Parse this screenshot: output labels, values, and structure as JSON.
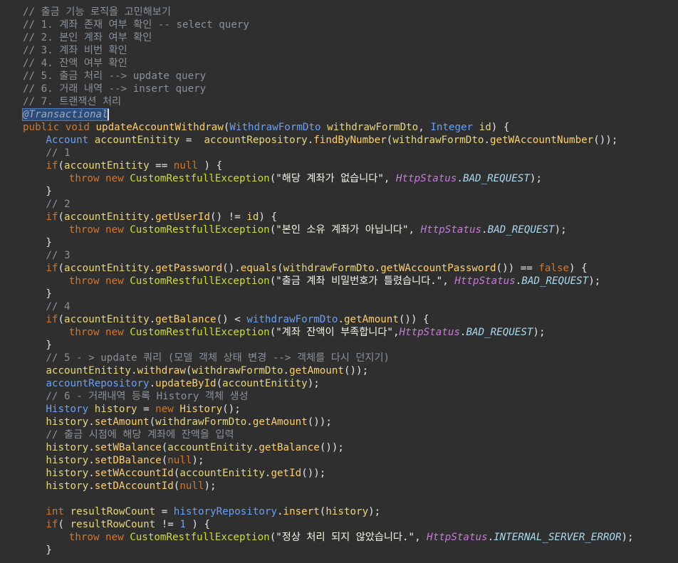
{
  "editor": {
    "lines": [
      {
        "indent": 4,
        "tokens": [
          {
            "t": "// 출금 기능 로직을 고민해보기",
            "c": "cm"
          }
        ]
      },
      {
        "indent": 4,
        "tokens": [
          {
            "t": "// 1. 계좌 존재 여부 확인 -- select query",
            "c": "cm"
          }
        ]
      },
      {
        "indent": 4,
        "tokens": [
          {
            "t": "// 2. 본인 계좌 여부 확인",
            "c": "cm"
          }
        ]
      },
      {
        "indent": 4,
        "tokens": [
          {
            "t": "// 3. 계좌 비번 확인",
            "c": "cm"
          }
        ]
      },
      {
        "indent": 4,
        "tokens": [
          {
            "t": "// 4. 잔액 여부 확인",
            "c": "cm"
          }
        ]
      },
      {
        "indent": 4,
        "tokens": [
          {
            "t": "// 5. 출금 처리 --> update query",
            "c": "cm"
          }
        ]
      },
      {
        "indent": 4,
        "tokens": [
          {
            "t": "// 6. 거래 내역 --> insert query",
            "c": "cm"
          }
        ]
      },
      {
        "indent": 4,
        "tokens": [
          {
            "t": "// 7. 트랜잭션 처리",
            "c": "cm"
          }
        ]
      },
      {
        "indent": 4,
        "tokens": [
          {
            "t": "@Transactional",
            "c": "ann"
          }
        ]
      },
      {
        "indent": 4,
        "tokens": [
          {
            "t": "public void ",
            "c": "kw"
          },
          {
            "t": "updateAccountWithdraw",
            "c": "fn"
          },
          {
            "t": "(",
            "c": "p"
          },
          {
            "t": "WithdrawFormDto ",
            "c": "ty"
          },
          {
            "t": "withdrawFormDto",
            "c": "var"
          },
          {
            "t": ", ",
            "c": "p"
          },
          {
            "t": "Integer ",
            "c": "ty"
          },
          {
            "t": "id",
            "c": "var"
          },
          {
            "t": ") {",
            "c": "p"
          }
        ]
      },
      {
        "indent": 8,
        "tokens": [
          {
            "t": "Account ",
            "c": "ty"
          },
          {
            "t": "accountEnitity",
            "c": "var"
          },
          {
            "t": " =  ",
            "c": "p"
          },
          {
            "t": "accountRepository",
            "c": "var"
          },
          {
            "t": ".",
            "c": "p"
          },
          {
            "t": "findByNumber",
            "c": "fn"
          },
          {
            "t": "(",
            "c": "p"
          },
          {
            "t": "withdrawFormDto",
            "c": "var"
          },
          {
            "t": ".",
            "c": "p"
          },
          {
            "t": "getWAccountNumber",
            "c": "fn"
          },
          {
            "t": "());",
            "c": "p"
          }
        ]
      },
      {
        "indent": 8,
        "tokens": [
          {
            "t": "// 1",
            "c": "cm"
          }
        ]
      },
      {
        "indent": 8,
        "tokens": [
          {
            "t": "if",
            "c": "kw"
          },
          {
            "t": "(",
            "c": "p"
          },
          {
            "t": "accountEnitity",
            "c": "var"
          },
          {
            "t": " == ",
            "c": "p"
          },
          {
            "t": "null",
            "c": "kw"
          },
          {
            "t": " ) {",
            "c": "p"
          }
        ]
      },
      {
        "indent": 12,
        "tokens": [
          {
            "t": "throw new ",
            "c": "kw"
          },
          {
            "t": "CustomRestfullException",
            "c": "cls"
          },
          {
            "t": "(",
            "c": "p"
          },
          {
            "t": "\"해당 계좌가 없습니다\"",
            "c": "str"
          },
          {
            "t": ", ",
            "c": "p"
          },
          {
            "t": "HttpStatus",
            "c": "hs"
          },
          {
            "t": ".",
            "c": "p"
          },
          {
            "t": "BAD_REQUEST",
            "c": "en"
          },
          {
            "t": ");",
            "c": "p"
          }
        ]
      },
      {
        "indent": 8,
        "tokens": [
          {
            "t": "}",
            "c": "p"
          }
        ]
      },
      {
        "indent": 8,
        "tokens": [
          {
            "t": "// 2",
            "c": "cm"
          }
        ]
      },
      {
        "indent": 8,
        "tokens": [
          {
            "t": "if",
            "c": "kw"
          },
          {
            "t": "(",
            "c": "p"
          },
          {
            "t": "accountEnitity",
            "c": "var"
          },
          {
            "t": ".",
            "c": "p"
          },
          {
            "t": "getUserId",
            "c": "fn"
          },
          {
            "t": "() != ",
            "c": "p"
          },
          {
            "t": "id",
            "c": "var"
          },
          {
            "t": ") {",
            "c": "p"
          }
        ]
      },
      {
        "indent": 12,
        "tokens": [
          {
            "t": "throw new ",
            "c": "kw"
          },
          {
            "t": "CustomRestfullException",
            "c": "cls"
          },
          {
            "t": "(",
            "c": "p"
          },
          {
            "t": "\"본인 소유 계좌가 아닙니다\"",
            "c": "str"
          },
          {
            "t": ", ",
            "c": "p"
          },
          {
            "t": "HttpStatus",
            "c": "hs"
          },
          {
            "t": ".",
            "c": "p"
          },
          {
            "t": "BAD_REQUEST",
            "c": "en"
          },
          {
            "t": ");",
            "c": "p"
          }
        ]
      },
      {
        "indent": 8,
        "tokens": [
          {
            "t": "}",
            "c": "p"
          }
        ]
      },
      {
        "indent": 8,
        "tokens": [
          {
            "t": "// 3",
            "c": "cm"
          }
        ]
      },
      {
        "indent": 8,
        "tokens": [
          {
            "t": "if",
            "c": "kw"
          },
          {
            "t": "(",
            "c": "p"
          },
          {
            "t": "accountEnitity",
            "c": "var"
          },
          {
            "t": ".",
            "c": "p"
          },
          {
            "t": "getPassword",
            "c": "fn"
          },
          {
            "t": "().",
            "c": "p"
          },
          {
            "t": "equals",
            "c": "fn"
          },
          {
            "t": "(",
            "c": "p"
          },
          {
            "t": "withdrawFormDto",
            "c": "var"
          },
          {
            "t": ".",
            "c": "p"
          },
          {
            "t": "getWAccountPassword",
            "c": "fn"
          },
          {
            "t": "()) == ",
            "c": "p"
          },
          {
            "t": "false",
            "c": "kw"
          },
          {
            "t": ") {",
            "c": "p"
          }
        ]
      },
      {
        "indent": 12,
        "tokens": [
          {
            "t": "throw new ",
            "c": "kw"
          },
          {
            "t": "CustomRestfullException",
            "c": "cls"
          },
          {
            "t": "(",
            "c": "p"
          },
          {
            "t": "\"출금 계좌 비밀번호가 틀렸습니다.\"",
            "c": "str"
          },
          {
            "t": ", ",
            "c": "p"
          },
          {
            "t": "HttpStatus",
            "c": "hs"
          },
          {
            "t": ".",
            "c": "p"
          },
          {
            "t": "BAD_REQUEST",
            "c": "en"
          },
          {
            "t": ");",
            "c": "p"
          }
        ]
      },
      {
        "indent": 8,
        "tokens": [
          {
            "t": "}",
            "c": "p"
          }
        ]
      },
      {
        "indent": 8,
        "tokens": [
          {
            "t": "// 4",
            "c": "cm"
          }
        ]
      },
      {
        "indent": 8,
        "tokens": [
          {
            "t": "if",
            "c": "kw"
          },
          {
            "t": "(",
            "c": "p"
          },
          {
            "t": "accountEnitity",
            "c": "var"
          },
          {
            "t": ".",
            "c": "p"
          },
          {
            "t": "getBalance",
            "c": "fn"
          },
          {
            "t": "() < ",
            "c": "p"
          },
          {
            "t": "withdrawFormDto",
            "c": "ty"
          },
          {
            "t": ".",
            "c": "p"
          },
          {
            "t": "getAmount",
            "c": "fn"
          },
          {
            "t": "()) {",
            "c": "p"
          }
        ]
      },
      {
        "indent": 12,
        "tokens": [
          {
            "t": "throw new ",
            "c": "kw"
          },
          {
            "t": "CustomRestfullException",
            "c": "cls"
          },
          {
            "t": "(",
            "c": "p"
          },
          {
            "t": "\"계좌 잔액이 부족합니다\"",
            "c": "str"
          },
          {
            "t": ",",
            "c": "p"
          },
          {
            "t": "HttpStatus",
            "c": "hs"
          },
          {
            "t": ".",
            "c": "p"
          },
          {
            "t": "BAD_REQUEST",
            "c": "en"
          },
          {
            "t": ");",
            "c": "p"
          }
        ]
      },
      {
        "indent": 8,
        "tokens": [
          {
            "t": "}",
            "c": "p"
          }
        ]
      },
      {
        "indent": 8,
        "tokens": [
          {
            "t": "// 5 - > update 쿼리 (모델 객체 상태 변경 --> 객체를 다시 던지기)",
            "c": "cm"
          }
        ]
      },
      {
        "indent": 8,
        "tokens": [
          {
            "t": "accountEnitity",
            "c": "var"
          },
          {
            "t": ".",
            "c": "p"
          },
          {
            "t": "withdraw",
            "c": "fn"
          },
          {
            "t": "(",
            "c": "p"
          },
          {
            "t": "withdrawFormDto",
            "c": "var"
          },
          {
            "t": ".",
            "c": "p"
          },
          {
            "t": "getAmount",
            "c": "fn"
          },
          {
            "t": "());",
            "c": "p"
          }
        ]
      },
      {
        "indent": 8,
        "tokens": [
          {
            "t": "accountRepository",
            "c": "ty"
          },
          {
            "t": ".",
            "c": "p"
          },
          {
            "t": "updateById",
            "c": "fn"
          },
          {
            "t": "(",
            "c": "p"
          },
          {
            "t": "accountEnitity",
            "c": "var"
          },
          {
            "t": ");",
            "c": "p"
          }
        ]
      },
      {
        "indent": 8,
        "tokens": [
          {
            "t": "// 6 - 거래내역 등록 History 객체 생성",
            "c": "cm"
          }
        ]
      },
      {
        "indent": 8,
        "tokens": [
          {
            "t": "History ",
            "c": "ty"
          },
          {
            "t": "history",
            "c": "var"
          },
          {
            "t": " = ",
            "c": "p"
          },
          {
            "t": "new ",
            "c": "kw"
          },
          {
            "t": "History",
            "c": "fn"
          },
          {
            "t": "();",
            "c": "p"
          }
        ]
      },
      {
        "indent": 8,
        "tokens": [
          {
            "t": "history",
            "c": "var"
          },
          {
            "t": ".",
            "c": "p"
          },
          {
            "t": "setAmount",
            "c": "fn"
          },
          {
            "t": "(",
            "c": "p"
          },
          {
            "t": "withdrawFormDto",
            "c": "var"
          },
          {
            "t": ".",
            "c": "p"
          },
          {
            "t": "getAmount",
            "c": "fn"
          },
          {
            "t": "());",
            "c": "p"
          }
        ]
      },
      {
        "indent": 8,
        "tokens": [
          {
            "t": "// 출금 시점에 해당 계좌에 잔액을 입력",
            "c": "cm"
          }
        ]
      },
      {
        "indent": 8,
        "tokens": [
          {
            "t": "history",
            "c": "var"
          },
          {
            "t": ".",
            "c": "p"
          },
          {
            "t": "setWBalance",
            "c": "fn"
          },
          {
            "t": "(",
            "c": "p"
          },
          {
            "t": "accountEnitity",
            "c": "var"
          },
          {
            "t": ".",
            "c": "p"
          },
          {
            "t": "getBalance",
            "c": "fn"
          },
          {
            "t": "());",
            "c": "p"
          }
        ]
      },
      {
        "indent": 8,
        "tokens": [
          {
            "t": "history",
            "c": "var"
          },
          {
            "t": ".",
            "c": "p"
          },
          {
            "t": "setDBalance",
            "c": "fn"
          },
          {
            "t": "(",
            "c": "p"
          },
          {
            "t": "null",
            "c": "kw"
          },
          {
            "t": ");",
            "c": "p"
          }
        ]
      },
      {
        "indent": 8,
        "tokens": [
          {
            "t": "history",
            "c": "var"
          },
          {
            "t": ".",
            "c": "p"
          },
          {
            "t": "setWAccountId",
            "c": "fn"
          },
          {
            "t": "(",
            "c": "p"
          },
          {
            "t": "accountEnitity",
            "c": "var"
          },
          {
            "t": ".",
            "c": "p"
          },
          {
            "t": "getId",
            "c": "fn"
          },
          {
            "t": "());",
            "c": "p"
          }
        ]
      },
      {
        "indent": 8,
        "tokens": [
          {
            "t": "history",
            "c": "var"
          },
          {
            "t": ".",
            "c": "p"
          },
          {
            "t": "setDAccountId",
            "c": "fn"
          },
          {
            "t": "(",
            "c": "p"
          },
          {
            "t": "null",
            "c": "kw"
          },
          {
            "t": ");",
            "c": "p"
          }
        ]
      },
      {
        "indent": 0,
        "tokens": []
      },
      {
        "indent": 8,
        "tokens": [
          {
            "t": "int ",
            "c": "kw"
          },
          {
            "t": "resultRowCount",
            "c": "var"
          },
          {
            "t": " = ",
            "c": "p"
          },
          {
            "t": "historyRepository",
            "c": "ty"
          },
          {
            "t": ".",
            "c": "p"
          },
          {
            "t": "insert",
            "c": "fn"
          },
          {
            "t": "(",
            "c": "p"
          },
          {
            "t": "history",
            "c": "var"
          },
          {
            "t": ");",
            "c": "p"
          }
        ]
      },
      {
        "indent": 8,
        "tokens": [
          {
            "t": "if",
            "c": "kw"
          },
          {
            "t": "( ",
            "c": "p"
          },
          {
            "t": "resultRowCount",
            "c": "var"
          },
          {
            "t": " != ",
            "c": "p"
          },
          {
            "t": "1",
            "c": "ty"
          },
          {
            "t": " ) {",
            "c": "p"
          }
        ]
      },
      {
        "indent": 12,
        "tokens": [
          {
            "t": "throw new ",
            "c": "kw"
          },
          {
            "t": "CustomRestfullException",
            "c": "cls"
          },
          {
            "t": "(",
            "c": "p"
          },
          {
            "t": "\"정상 처리 되지 않았습니다.\"",
            "c": "str"
          },
          {
            "t": ", ",
            "c": "p"
          },
          {
            "t": "HttpStatus",
            "c": "hs"
          },
          {
            "t": ".",
            "c": "p"
          },
          {
            "t": "INTERNAL_SERVER_ERROR",
            "c": "en"
          },
          {
            "t": ");",
            "c": "p"
          }
        ]
      },
      {
        "indent": 8,
        "tokens": [
          {
            "t": "}",
            "c": "p"
          }
        ]
      }
    ]
  }
}
